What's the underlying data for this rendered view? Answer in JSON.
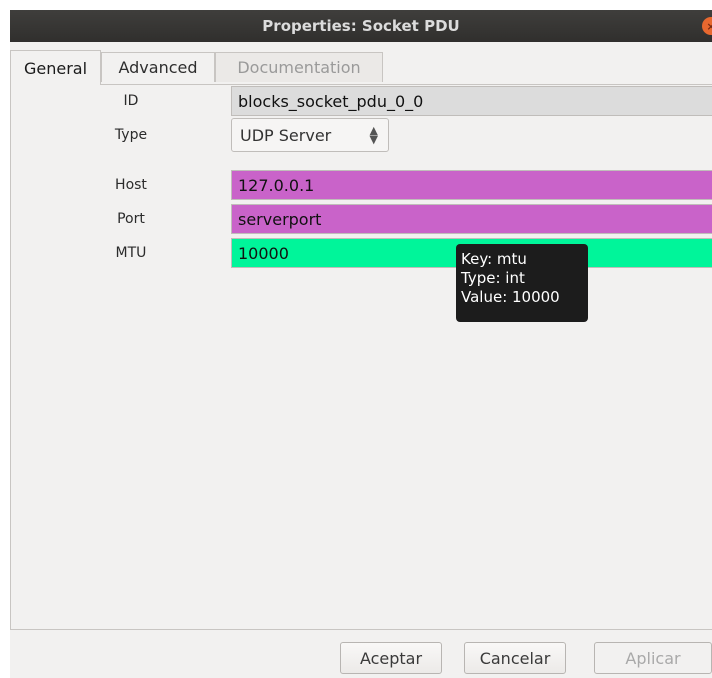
{
  "window": {
    "title": "Properties: Socket PDU"
  },
  "tabs": [
    {
      "label": "General",
      "active": true
    },
    {
      "label": "Advanced",
      "active": false
    },
    {
      "label": "Documentation",
      "disabled": true
    }
  ],
  "fields": {
    "id": {
      "label": "ID",
      "value": "blocks_socket_pdu_0_0",
      "color": "#dcdcdc"
    },
    "type": {
      "label": "Type",
      "value": "UDP Server"
    },
    "host": {
      "label": "Host",
      "value": "127.0.0.1",
      "color": "#c963c9"
    },
    "port": {
      "label": "Port",
      "value": "serverport",
      "color": "#c963c9"
    },
    "mtu": {
      "label": "MTU",
      "value": "10000",
      "color": "#00f59a"
    }
  },
  "tooltip": {
    "line1": "Key: mtu",
    "line2": "Type: int",
    "line3": "Value: 10000"
  },
  "buttons": {
    "accept": "Aceptar",
    "cancel": "Cancelar",
    "apply": "Aplicar"
  }
}
